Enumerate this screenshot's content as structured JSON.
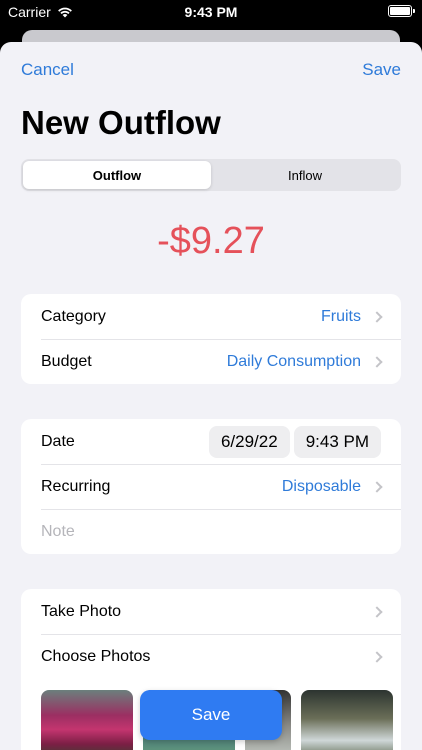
{
  "status": {
    "carrier": "Carrier",
    "time": "9:43 PM"
  },
  "nav": {
    "cancel": "Cancel",
    "save": "Save"
  },
  "title": "New Outflow",
  "segments": [
    {
      "label": "Outflow",
      "selected": true
    },
    {
      "label": "Inflow",
      "selected": false
    }
  ],
  "amount": "-$9.27",
  "colors": {
    "accent": "#2f7bd9",
    "amount": "#e5515a",
    "background": "#f2f2f7",
    "button": "#2f7bf2"
  },
  "classification": {
    "category": {
      "label": "Category",
      "value": "Fruits"
    },
    "budget": {
      "label": "Budget",
      "value": "Daily Consumption"
    }
  },
  "details": {
    "date": {
      "label": "Date",
      "date_value": "6/29/22",
      "time_value": "9:43 PM"
    },
    "recurring": {
      "label": "Recurring",
      "value": "Disposable"
    },
    "note": {
      "placeholder": "Note"
    }
  },
  "attachments": {
    "take_photo": "Take Photo",
    "choose_photos": "Choose Photos"
  },
  "save_button": "Save"
}
